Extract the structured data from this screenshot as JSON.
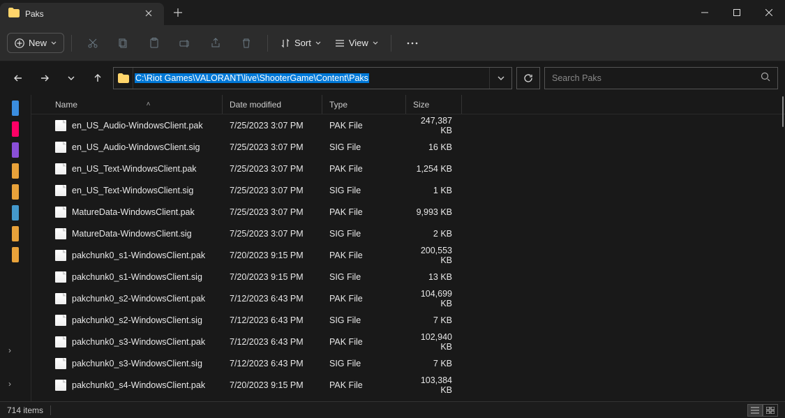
{
  "tab": {
    "title": "Paks"
  },
  "toolbar": {
    "new_label": "New",
    "sort_label": "Sort",
    "view_label": "View"
  },
  "address": {
    "path_text": "C:\\Riot Games\\VALORANT\\live\\ShooterGame\\Content\\Paks"
  },
  "search": {
    "placeholder": "Search Paks"
  },
  "columns": {
    "name": "Name",
    "date": "Date modified",
    "type": "Type",
    "size": "Size"
  },
  "files": [
    {
      "name": "en_US_Audio-WindowsClient.pak",
      "date": "7/25/2023 3:07 PM",
      "type": "PAK File",
      "size": "247,387 KB"
    },
    {
      "name": "en_US_Audio-WindowsClient.sig",
      "date": "7/25/2023 3:07 PM",
      "type": "SIG File",
      "size": "16 KB"
    },
    {
      "name": "en_US_Text-WindowsClient.pak",
      "date": "7/25/2023 3:07 PM",
      "type": "PAK File",
      "size": "1,254 KB"
    },
    {
      "name": "en_US_Text-WindowsClient.sig",
      "date": "7/25/2023 3:07 PM",
      "type": "SIG File",
      "size": "1 KB"
    },
    {
      "name": "MatureData-WindowsClient.pak",
      "date": "7/25/2023 3:07 PM",
      "type": "PAK File",
      "size": "9,993 KB"
    },
    {
      "name": "MatureData-WindowsClient.sig",
      "date": "7/25/2023 3:07 PM",
      "type": "SIG File",
      "size": "2 KB"
    },
    {
      "name": "pakchunk0_s1-WindowsClient.pak",
      "date": "7/20/2023 9:15 PM",
      "type": "PAK File",
      "size": "200,553 KB"
    },
    {
      "name": "pakchunk0_s1-WindowsClient.sig",
      "date": "7/20/2023 9:15 PM",
      "type": "SIG File",
      "size": "13 KB"
    },
    {
      "name": "pakchunk0_s2-WindowsClient.pak",
      "date": "7/12/2023 6:43 PM",
      "type": "PAK File",
      "size": "104,699 KB"
    },
    {
      "name": "pakchunk0_s2-WindowsClient.sig",
      "date": "7/12/2023 6:43 PM",
      "type": "SIG File",
      "size": "7 KB"
    },
    {
      "name": "pakchunk0_s3-WindowsClient.pak",
      "date": "7/12/2023 6:43 PM",
      "type": "PAK File",
      "size": "102,940 KB"
    },
    {
      "name": "pakchunk0_s3-WindowsClient.sig",
      "date": "7/12/2023 6:43 PM",
      "type": "SIG File",
      "size": "7 KB"
    },
    {
      "name": "pakchunk0_s4-WindowsClient.pak",
      "date": "7/20/2023 9:15 PM",
      "type": "PAK File",
      "size": "103,384 KB"
    }
  ],
  "status": {
    "item_count": "714 items"
  },
  "sidebar_colors": [
    "#3a8ddf",
    "#f06",
    "#8a4fd8",
    "#e8a23a",
    "#e8a23a",
    "#49c",
    "#e8a23a",
    "#e8a23a"
  ]
}
